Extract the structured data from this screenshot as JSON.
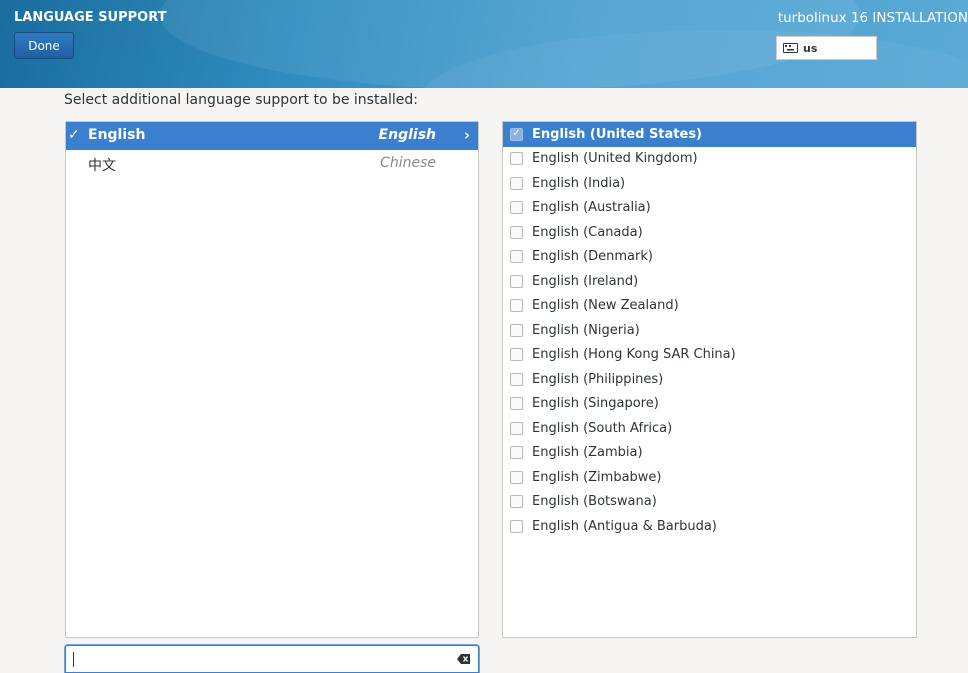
{
  "header": {
    "title": "LANGUAGE SUPPORT",
    "done_label": "Done",
    "product": "turbolinux 16 INSTALLATION",
    "keyboard_layout": "us"
  },
  "prompt": "Select additional language support to be installed:",
  "languages": [
    {
      "native": "English",
      "english": "English",
      "checked": true,
      "selected": true
    },
    {
      "native": "中文",
      "english": "Chinese",
      "checked": false,
      "selected": false
    }
  ],
  "locales": [
    {
      "label": "English (United States)",
      "checked": true,
      "selected": true
    },
    {
      "label": "English (United Kingdom)",
      "checked": false
    },
    {
      "label": "English (India)",
      "checked": false
    },
    {
      "label": "English (Australia)",
      "checked": false
    },
    {
      "label": "English (Canada)",
      "checked": false
    },
    {
      "label": "English (Denmark)",
      "checked": false
    },
    {
      "label": "English (Ireland)",
      "checked": false
    },
    {
      "label": "English (New Zealand)",
      "checked": false
    },
    {
      "label": "English (Nigeria)",
      "checked": false
    },
    {
      "label": "English (Hong Kong SAR China)",
      "checked": false
    },
    {
      "label": "English (Philippines)",
      "checked": false
    },
    {
      "label": "English (Singapore)",
      "checked": false
    },
    {
      "label": "English (South Africa)",
      "checked": false
    },
    {
      "label": "English (Zambia)",
      "checked": false
    },
    {
      "label": "English (Zimbabwe)",
      "checked": false
    },
    {
      "label": "English (Botswana)",
      "checked": false
    },
    {
      "label": "English (Antigua & Barbuda)",
      "checked": false
    }
  ],
  "search": {
    "value": ""
  },
  "colors": {
    "accent": "#3a80cf",
    "header": "#2f8cbf"
  }
}
